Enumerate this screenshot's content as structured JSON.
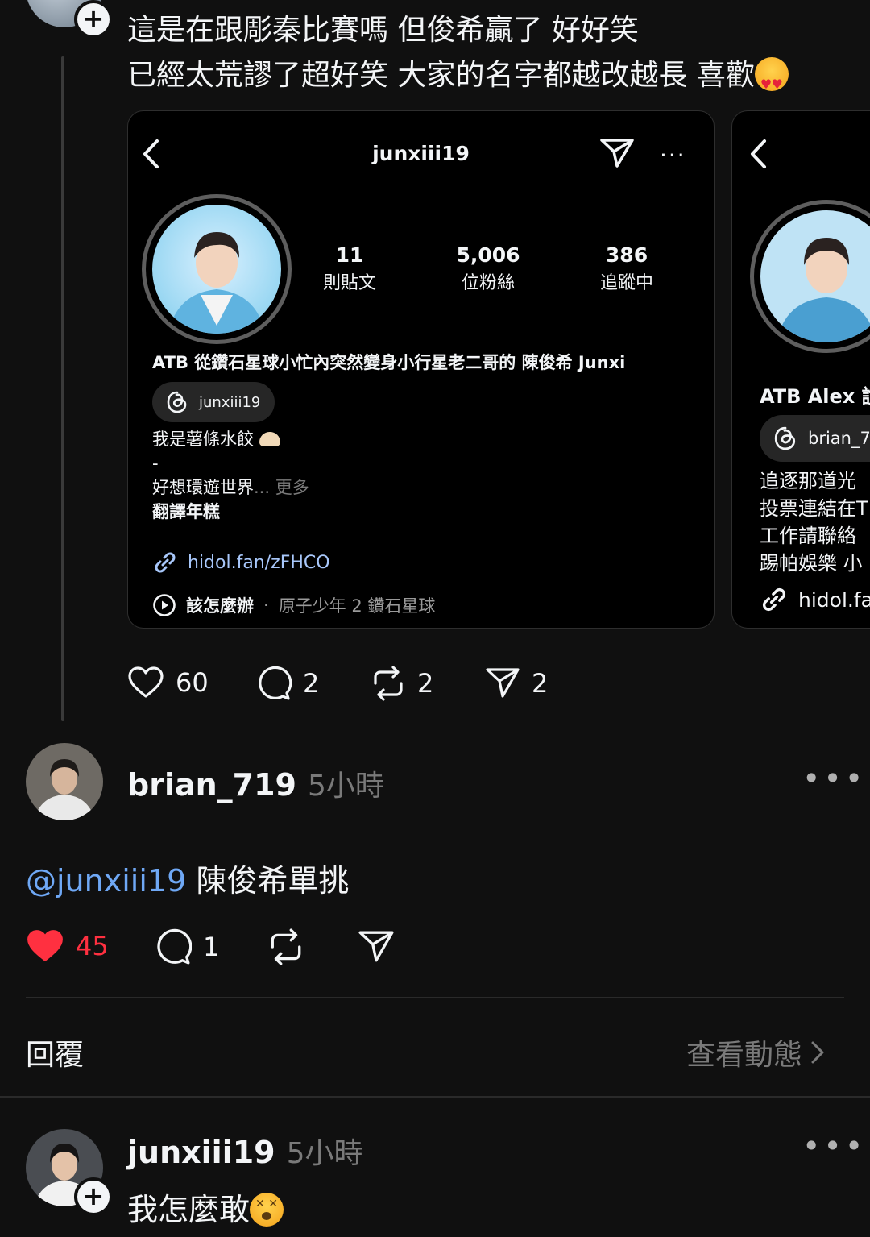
{
  "post": {
    "text_line1": "這是在跟彫秦比賽嗎 但俊希贏了 好好笑",
    "text_line2": "已經太荒謬了超好笑 大家的名字都越改越長 喜歡",
    "emoji": "heart-eyes",
    "actions": {
      "likes": "60",
      "comments": "2",
      "reposts": "2",
      "shares": "2"
    }
  },
  "card1": {
    "username": "junxiii19",
    "stats": [
      {
        "number": "11",
        "label": "則貼文"
      },
      {
        "number": "5,006",
        "label": "位粉絲"
      },
      {
        "number": "386",
        "label": "追蹤中"
      }
    ],
    "name": "ATB 從鑽石星球小忙內突然變身小行星老二哥的 陳俊希 Junxi",
    "threads_pill": "junxiii19",
    "bio_line1": "我是薯條水餃",
    "bio_line2": "-",
    "bio_line3": "好想環遊世界",
    "bio_more": "... 更多",
    "bio_line4": "翻譯年糕",
    "link": "hidol.fan/zFHCO",
    "music_song": "該怎麼辦",
    "music_sep": "·",
    "music_artist": "原子少年 2 鑽石星球"
  },
  "card2": {
    "name": "ATB Alex 說",
    "threads_pill": "brian_7",
    "bio_line1": "追逐那道光",
    "bio_line2": "投票連結在T",
    "bio_line3": "工作請聯絡",
    "bio_line4": "踢帕娛樂 小",
    "link": "hidol.fa"
  },
  "reply1": {
    "username": "brian_719",
    "time": "5小時",
    "mention": "@junxiii19",
    "text": " 陳俊希單挑",
    "likes": "45",
    "comments": "1",
    "liked": true,
    "like_color": "#ff3040"
  },
  "footer": {
    "reply_label": "回覆",
    "view_activity": "查看動態"
  },
  "reply2": {
    "username": "junxiii19",
    "time": "5小時",
    "text": "我怎麼敢",
    "emoji": "dizzy-face"
  }
}
